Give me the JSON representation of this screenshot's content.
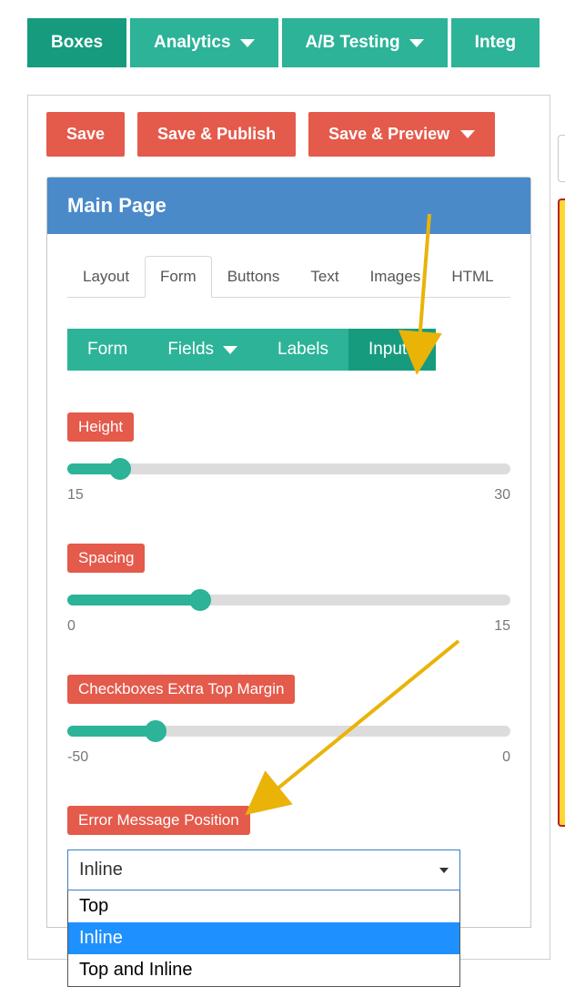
{
  "nav": {
    "items": [
      {
        "label": "Boxes",
        "active": true,
        "dropdown": false
      },
      {
        "label": "Analytics",
        "active": false,
        "dropdown": true
      },
      {
        "label": "A/B Testing",
        "active": false,
        "dropdown": true
      },
      {
        "label": "Integ",
        "active": false,
        "dropdown": false
      }
    ]
  },
  "actions": {
    "save": "Save",
    "save_publish": "Save & Publish",
    "save_preview": "Save & Preview"
  },
  "panel": {
    "title": "Main Page",
    "tabs": [
      {
        "label": "Layout"
      },
      {
        "label": "Form",
        "active": true
      },
      {
        "label": "Buttons"
      },
      {
        "label": "Text"
      },
      {
        "label": "Images"
      },
      {
        "label": "HTML"
      }
    ],
    "pills": [
      {
        "label": "Form"
      },
      {
        "label": "Fields",
        "dropdown": true
      },
      {
        "label": "Labels"
      },
      {
        "label": "Inputs",
        "selected": true
      }
    ],
    "sliders": {
      "height": {
        "label": "Height",
        "min": "15",
        "max": "30",
        "percent": 12
      },
      "spacing": {
        "label": "Spacing",
        "min": "0",
        "max": "15",
        "percent": 30
      },
      "cbmargin": {
        "label": "Checkboxes Extra Top Margin",
        "min": "-50",
        "max": "0",
        "percent": 20
      }
    },
    "select": {
      "label": "Error Message Position",
      "value": "Inline",
      "options": [
        "Top",
        "Inline",
        "Top and Inline"
      ],
      "highlight_index": 1
    }
  }
}
